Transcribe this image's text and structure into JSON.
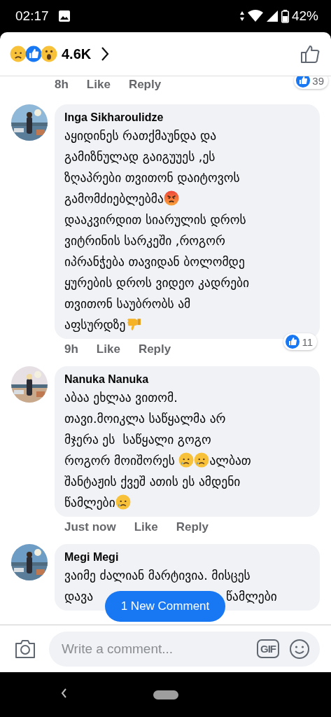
{
  "status_bar": {
    "time": "02:17",
    "battery": "42%"
  },
  "header": {
    "reaction_count": "4.6K"
  },
  "comments": [
    {
      "time": "8h",
      "like": "Like",
      "reply": "Reply",
      "reactions": "39"
    },
    {
      "author": "Inga Sikharoulidze",
      "body": [
        {
          "kind": "text",
          "text": "აყიდინეს რათქმაუნდა და\nგამიზნულად გაიგუუეს ,ეს\nზღაპრები თვითონ დაიტოვოს\nგამომძიებლებმა"
        },
        {
          "kind": "angry"
        },
        {
          "kind": "text",
          "text": "\nდააკვირდით სიარულის დროს\nვიტრინის სარკეში ,როგორ\nიპრანჭება თავიდან ბოლომდე\nყურების დროს ვიდეო კადრები\nთვითონ საუბრობს ამ\nაფსურდზე"
        },
        {
          "kind": "thumbsdown"
        }
      ],
      "time": "9h",
      "like": "Like",
      "reply": "Reply",
      "reactions": "11"
    },
    {
      "author": "Nanuka Nanuka",
      "body": [
        {
          "kind": "text",
          "text": "აბაა ეხლაა ვითომ.\nთავი.მოიკლა საწყალმა არ\nმჯერა ეს  საწყალი გოგო\nროგორ მოიშორეს "
        },
        {
          "kind": "crying"
        },
        {
          "kind": "crying"
        },
        {
          "kind": "text",
          "text": "ალბათ\nშანტაჟის ქვეშ ათის ეს ამდენი\nწამლები"
        },
        {
          "kind": "crying"
        }
      ],
      "time": "Just now",
      "like": "Like",
      "reply": "Reply"
    },
    {
      "author": "Megi Megi",
      "body": [
        {
          "kind": "text",
          "text": "ვაიმე ძალიან მარტივია. მისცეს"
        },
        {
          "kind": "text",
          "text": "დავა"
        },
        {
          "kind": "covered"
        },
        {
          "kind": "text",
          "text": "წამლები"
        }
      ]
    }
  ],
  "new_comment_button": "1 New Comment",
  "composer": {
    "placeholder": "Write a comment...",
    "gif": "GIF"
  }
}
